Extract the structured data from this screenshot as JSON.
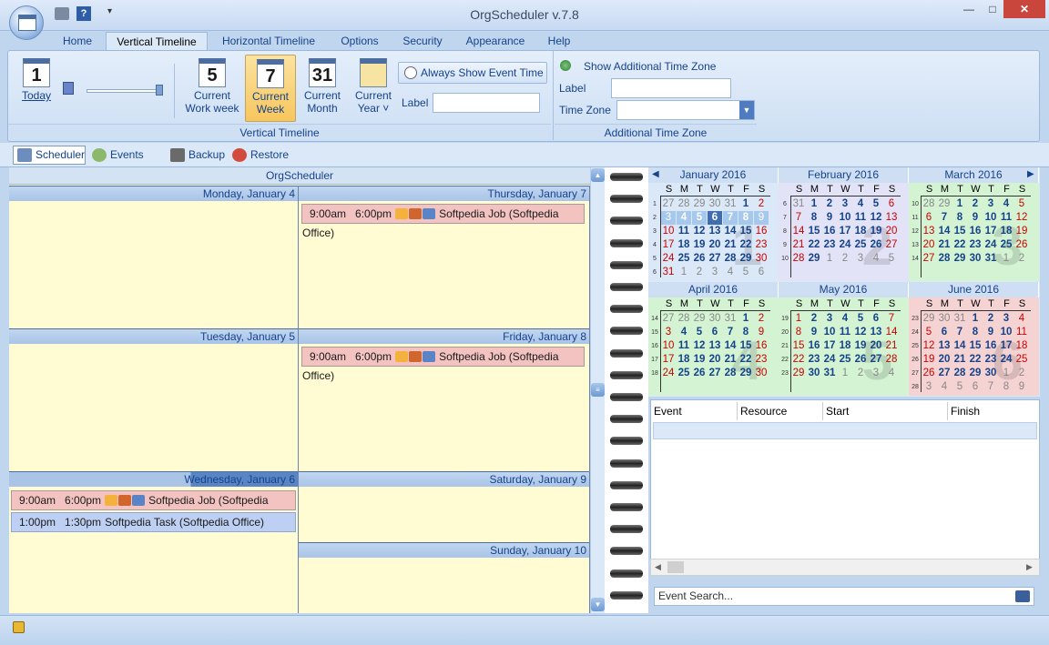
{
  "window": {
    "title": "OrgScheduler v.7.8",
    "minimize": "—",
    "maximize": "□",
    "close": "✕",
    "qa_help": "?",
    "qa_more": "▾"
  },
  "menu_tabs": [
    "Home",
    "Vertical Timeline",
    "Horizontal Timeline",
    "Options",
    "Security",
    "Appearance",
    "Help"
  ],
  "ribbon": {
    "today": {
      "label": "Today",
      "icon_num": "1"
    },
    "work_week": {
      "label": "Current Work week",
      "icon_num": "5"
    },
    "week": {
      "label": "Current Week",
      "icon_num": "7"
    },
    "month": {
      "label": "Current Month",
      "icon_num": "31"
    },
    "year": {
      "label": "Current Year ˅"
    },
    "always_show": "Always Show Event Time",
    "label_field": "Label",
    "group_vertical": "Vertical Timeline",
    "show_tz": "Show Additional Time Zone",
    "tz_label": "Label",
    "tz_zone": "Time Zone",
    "group_tz": "Additional Time Zone"
  },
  "toolbar": [
    "Scheduler",
    "Events List",
    "Backup",
    "Restore"
  ],
  "scheduler": {
    "title": "OrgScheduler",
    "days": {
      "mon": "Monday, January 4",
      "tue": "Tuesday, January 5",
      "wed": "Wednesday, January 6",
      "thu": "Thursday, January 7",
      "fri": "Friday, January 8",
      "sat": "Saturday, January 9",
      "sun": "Sunday, January 10"
    },
    "events": {
      "job": {
        "start": "9:00am",
        "end": "6:00pm",
        "text": "Softpedia Job (Softpedia Office)"
      },
      "task": {
        "start": "1:00pm",
        "end": "1:30pm",
        "text": "Softpedia Task (Softpedia Office)"
      }
    }
  },
  "minical": {
    "dayheads": [
      "S",
      "M",
      "T",
      "W",
      "T",
      "F",
      "S"
    ],
    "prev": "◀",
    "next": "▶",
    "months": [
      {
        "name": "January 2016",
        "wm": "1",
        "weeks": [
          "1",
          "2",
          "3",
          "4",
          "5",
          "6"
        ],
        "start": 0,
        "len": 31,
        "prevTail": [
          "27",
          "28",
          "29",
          "30",
          "31"
        ]
      },
      {
        "name": "February 2016",
        "wm": "2",
        "weeks": [
          "6",
          "7",
          "8",
          "9",
          "10"
        ]
      },
      {
        "name": "March 2016",
        "wm": "3",
        "weeks": [
          "10",
          "11",
          "12",
          "13",
          "14"
        ]
      },
      {
        "name": "April 2016",
        "wm": "4",
        "weeks": [
          "14",
          "15",
          "16",
          "17",
          "18"
        ]
      },
      {
        "name": "May 2016",
        "wm": "5",
        "weeks": [
          "19",
          "20",
          "21",
          "22",
          "23"
        ]
      },
      {
        "name": "June 2016",
        "wm": "6",
        "weeks": [
          "23",
          "24",
          "25",
          "26",
          "27",
          "28"
        ]
      }
    ]
  },
  "event_list": {
    "columns": [
      "Event",
      "Resource",
      "Start",
      "Finish"
    ],
    "search_placeholder": "Event Search..."
  },
  "colors": {
    "accent": "#15428b",
    "job": "#f2c3c0",
    "task": "#bdcff2",
    "day_bg": "#fffbd3"
  }
}
